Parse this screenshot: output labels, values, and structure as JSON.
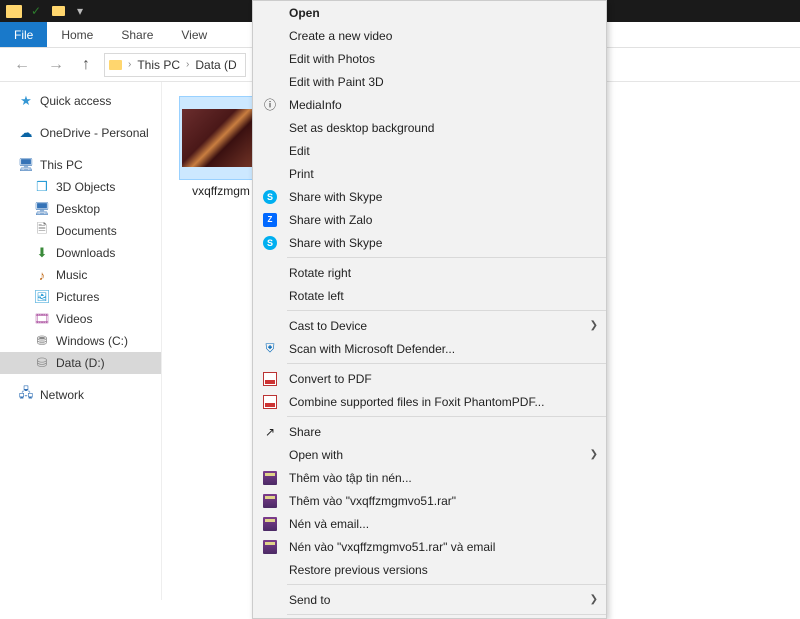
{
  "titlebar": {},
  "ribbon": {
    "file": "File",
    "home": "Home",
    "share": "Share",
    "view": "View"
  },
  "nav": {
    "pc": "This PC",
    "drive": "Data (D"
  },
  "sidebar": {
    "quick": "Quick access",
    "onedrive": "OneDrive - Personal",
    "thispc": "This PC",
    "items": [
      {
        "label": "3D Objects"
      },
      {
        "label": "Desktop"
      },
      {
        "label": "Documents"
      },
      {
        "label": "Downloads"
      },
      {
        "label": "Music"
      },
      {
        "label": "Pictures"
      },
      {
        "label": "Videos"
      },
      {
        "label": "Windows (C:)"
      },
      {
        "label": "Data (D:)"
      }
    ],
    "network": "Network"
  },
  "file": {
    "name": "vxqffzmgm"
  },
  "ctx": {
    "open": "Open",
    "newvideo": "Create a new video",
    "editphotos": "Edit with Photos",
    "paint3d": "Edit with Paint 3D",
    "mediainfo": "MediaInfo",
    "setbg": "Set as desktop background",
    "edit": "Edit",
    "print": "Print",
    "skype1": "Share with Skype",
    "zalo": "Share with Zalo",
    "skype2": "Share with Skype",
    "rotr": "Rotate right",
    "rotl": "Rotate left",
    "cast": "Cast to Device",
    "defender": "Scan with Microsoft Defender...",
    "pdf": "Convert to PDF",
    "foxit": "Combine supported files in Foxit PhantomPDF...",
    "share": "Share",
    "openwith": "Open with",
    "rar1": "Thêm vào tập tin nén...",
    "rar2": "Thêm vào \"vxqffzmgmvo51.rar\"",
    "rar3": "Nén và email...",
    "rar4": "Nén vào \"vxqffzmgmvo51.rar\" và email",
    "restore": "Restore previous versions",
    "sendto": "Send to"
  }
}
